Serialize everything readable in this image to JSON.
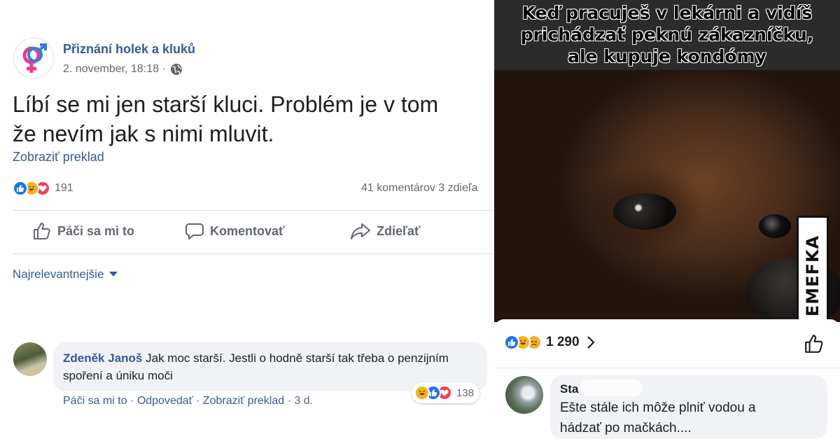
{
  "post": {
    "page_name": "Přiznání holek a kluků",
    "date": "2. november, 18:18 ·",
    "text_line1": "Líbí se mi jen starší kluci. Problém je v tom",
    "text_line2": "že nevím jak s nimi mluvit.",
    "see_translation": "Zobraziť preklad",
    "reactions_count": "191",
    "comments_shares": "41 komentárov  3 zdieľa",
    "actions": {
      "like": "Páči sa mi to",
      "comment": "Komentovať",
      "share": "Zdieľať"
    },
    "sort_label": "Najrelevantnejšie"
  },
  "comment": {
    "author": "Zdeněk Janoš",
    "text": "Jak moc starší. Jestli o hodně starší tak třeba o penzijním spoření a úniku moči",
    "reactions_count": "138",
    "like": "Páči sa mi to",
    "reply": "Odpovedať",
    "translate": "Zobraziť preklad",
    "time": "3 d.",
    "separator": " · "
  },
  "meme": {
    "caption_line1": "Keď pracuješ v lekárni a vidíš",
    "caption_line2": "prichádzať peknú zákazníčku,",
    "caption_line3": "ale kupuje kondómy",
    "watermark": "EMEFKA",
    "reactions_count": "1 290",
    "reply_author": "Sta",
    "reply_text_line1": "Ešte stále ich môže plniť vodou a",
    "reply_text_line2": "hádzať po mačkách...."
  },
  "colors": {
    "link": "#385898",
    "like_blue": "#1877f2",
    "haha_yellow": "#f7b125",
    "love_red": "#f33e58",
    "bubble_bg": "#f0f2f5"
  }
}
